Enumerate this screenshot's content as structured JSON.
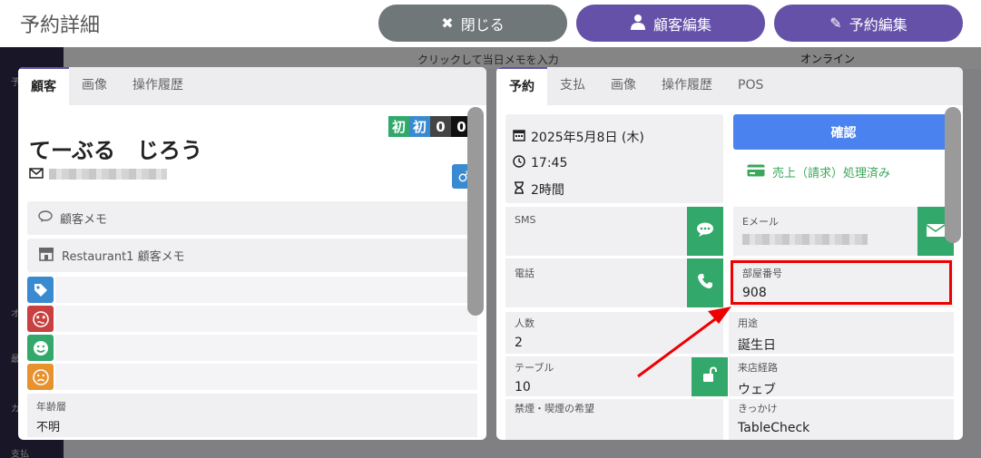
{
  "header": {
    "title": "予約詳細",
    "close_label": "閉じる",
    "customer_edit_label": "顧客編集",
    "reservation_edit_label": "予約編集"
  },
  "background": {
    "memo_prompt": "クリックして当日メモを入力",
    "online_label": "オンライン",
    "side_labels": [
      "予",
      "オ",
      "最",
      "カ",
      "支払"
    ]
  },
  "left_panel": {
    "tabs": [
      "顧客",
      "画像",
      "操作履歴"
    ],
    "customer_name": "てーぶる　じろう",
    "badges": [
      "初",
      "初",
      "0",
      "0"
    ],
    "customer_memo_label": "顧客メモ",
    "restaurant_memo_label": "Restaurant1 顧客メモ",
    "age_label": "年齢層",
    "age_value": "不明"
  },
  "right_panel": {
    "tabs": [
      "予約",
      "支払",
      "画像",
      "操作履歴",
      "POS"
    ],
    "date": "2025年5月8日 (木)",
    "time": "17:45",
    "duration": "2時間",
    "confirm_label": "確認",
    "sales_status": "売上（請求）処理済み",
    "sms_label": "SMS",
    "email_label": "Eメール",
    "phone_label": "電話",
    "room_label": "部屋番号",
    "room_value": "908",
    "people_label": "人数",
    "people_value": "2",
    "purpose_label": "用途",
    "purpose_value": "誕生日",
    "table_label": "テーブル",
    "table_value": "10",
    "route_label": "来店経路",
    "route_value": "ウェブ",
    "smoking_label": "禁煙・喫煙の希望",
    "trigger_label": "きっかけ",
    "trigger_value": "TableCheck"
  },
  "colors": {
    "purple": "#6552a8",
    "gray_button": "#6f7779",
    "confirm_blue": "#4a82f0",
    "green": "#32a86a",
    "highlight_red": "#e00000"
  }
}
